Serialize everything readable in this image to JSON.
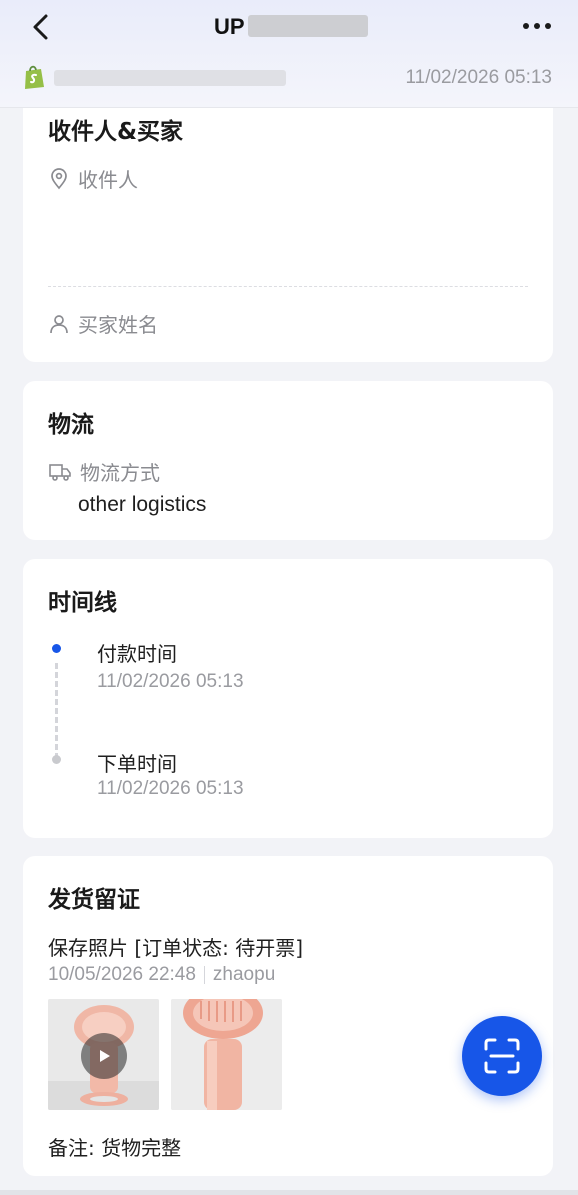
{
  "header": {
    "title_visible_part": "UP",
    "back_icon": "chevron-left-icon",
    "more_icon": "more-horizontal-icon",
    "shop_icon": "shopify-bag-icon",
    "order_time": "11/02/2026 05:13"
  },
  "recipient_card": {
    "title": "收件人&买家",
    "recipient_label": "收件人",
    "buyer_name_label": "买家姓名"
  },
  "logistics_card": {
    "title": "物流",
    "method_label": "物流方式",
    "method_value": "other logistics"
  },
  "timeline_card": {
    "title": "时间线",
    "events": [
      {
        "label": "付款时间",
        "time": "11/02/2026 05:13",
        "active": true
      },
      {
        "label": "下单时间",
        "time": "11/02/2026 05:13",
        "active": false
      }
    ]
  },
  "proof_card": {
    "title": "发货留证",
    "photo_status": "保存照片 [订单状态: 待开票]",
    "date": "10/05/2026 22:48",
    "operator": "zhaopu",
    "note": "备注: 货物完整"
  },
  "colors": {
    "accent": "#1756e8",
    "shopify_green": "#95bf47"
  },
  "fab": {
    "icon": "scan-icon"
  }
}
